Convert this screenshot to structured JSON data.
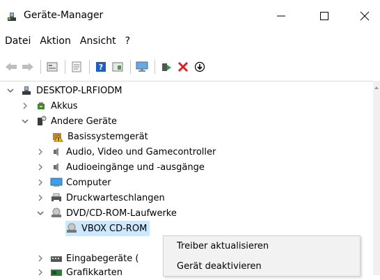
{
  "window": {
    "title": "Geräte-Manager"
  },
  "menu": {
    "items": [
      "Datei",
      "Aktion",
      "Ansicht",
      "?"
    ]
  },
  "toolbar": {
    "icons": [
      "back-icon",
      "forward-icon",
      "properties-icon",
      "details-icon",
      "help-icon",
      "view-icon",
      "monitor-icon",
      "update-driver-icon",
      "uninstall-icon",
      "disable-icon"
    ]
  },
  "tree": {
    "root": "DESKTOP-LRFIODM",
    "items": [
      {
        "label": "Akkus"
      },
      {
        "label": "Andere Geräte"
      },
      {
        "label": "Basissystemgerät"
      },
      {
        "label": "Audio, Video und Gamecontroller"
      },
      {
        "label": "Audioeingänge und -ausgänge"
      },
      {
        "label": "Computer"
      },
      {
        "label": "Druckwarteschlangen"
      },
      {
        "label": "DVD/CD-ROM-Laufwerke"
      },
      {
        "label": "VBOX CD-ROM"
      },
      {
        "label": "Eingabegeräte ("
      },
      {
        "label": "Grafikkarten"
      }
    ]
  },
  "context_menu": {
    "items": [
      "Treiber aktualisieren",
      "Gerät deaktivieren"
    ]
  }
}
